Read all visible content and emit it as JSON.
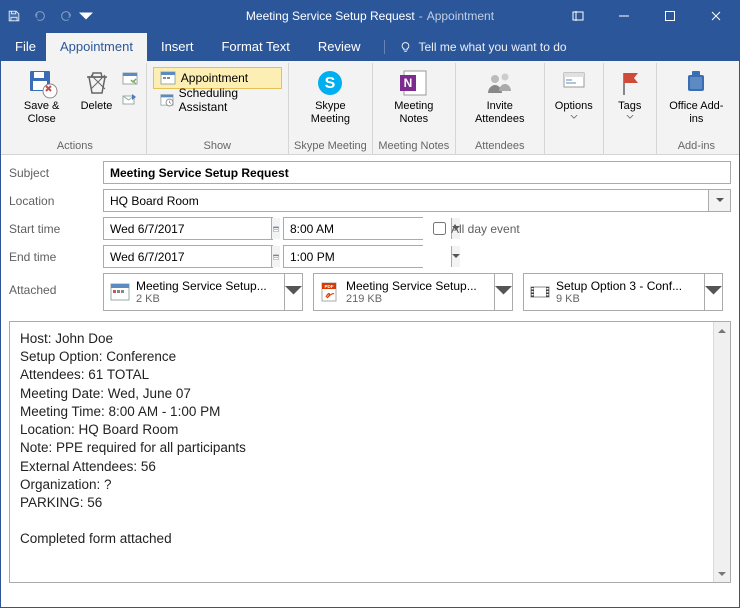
{
  "title": {
    "text": "Meeting Service Setup Request",
    "suffix": "Appointment"
  },
  "menu": {
    "file": "File",
    "appointment": "Appointment",
    "insert": "Insert",
    "formatText": "Format Text",
    "review": "Review",
    "tellme": "Tell me what you want to do"
  },
  "ribbon": {
    "actions": {
      "saveClose": "Save &\nClose",
      "delete": "Delete",
      "label": "Actions"
    },
    "show": {
      "appointment": "Appointment",
      "scheduling": "Scheduling Assistant",
      "label": "Show"
    },
    "skype": {
      "btn": "Skype\nMeeting",
      "label": "Skype Meeting"
    },
    "notes": {
      "btn": "Meeting\nNotes",
      "label": "Meeting Notes"
    },
    "attendees": {
      "btn": "Invite\nAttendees",
      "label": "Attendees"
    },
    "options": {
      "btn": "Options",
      "label": ""
    },
    "tags": {
      "btn": "Tags",
      "label": ""
    },
    "addins": {
      "btn": "Office\nAdd-ins",
      "label": "Add-ins"
    }
  },
  "form": {
    "subjectLabel": "Subject",
    "subject": "Meeting Service Setup Request",
    "locationLabel": "Location",
    "location": "HQ Board Room",
    "startLabel": "Start time",
    "startDate": "Wed 6/7/2017",
    "startTime": "8:00 AM",
    "allDay": "All day event",
    "endLabel": "End time",
    "endDate": "Wed 6/7/2017",
    "endTime": "1:00 PM",
    "attachedLabel": "Attached"
  },
  "attachments": [
    {
      "name": "Meeting Service Setup...",
      "size": "2 KB",
      "type": "cal"
    },
    {
      "name": "Meeting Service Setup...",
      "size": "219 KB",
      "type": "pdf"
    },
    {
      "name": "Setup Option 3 - Conf...",
      "size": "9 KB",
      "type": "vid"
    }
  ],
  "body": "Host: John Doe\nSetup Option: Conference\nAttendees: 61 TOTAL\nMeeting Date: Wed, June 07\nMeeting Time: 8:00 AM - 1:00 PM\nLocation: HQ Board Room\nNote: PPE required for all participants\nExternal Attendees: 56\nOrganization: ?\nPARKING: 56\n\nCompleted form attached"
}
